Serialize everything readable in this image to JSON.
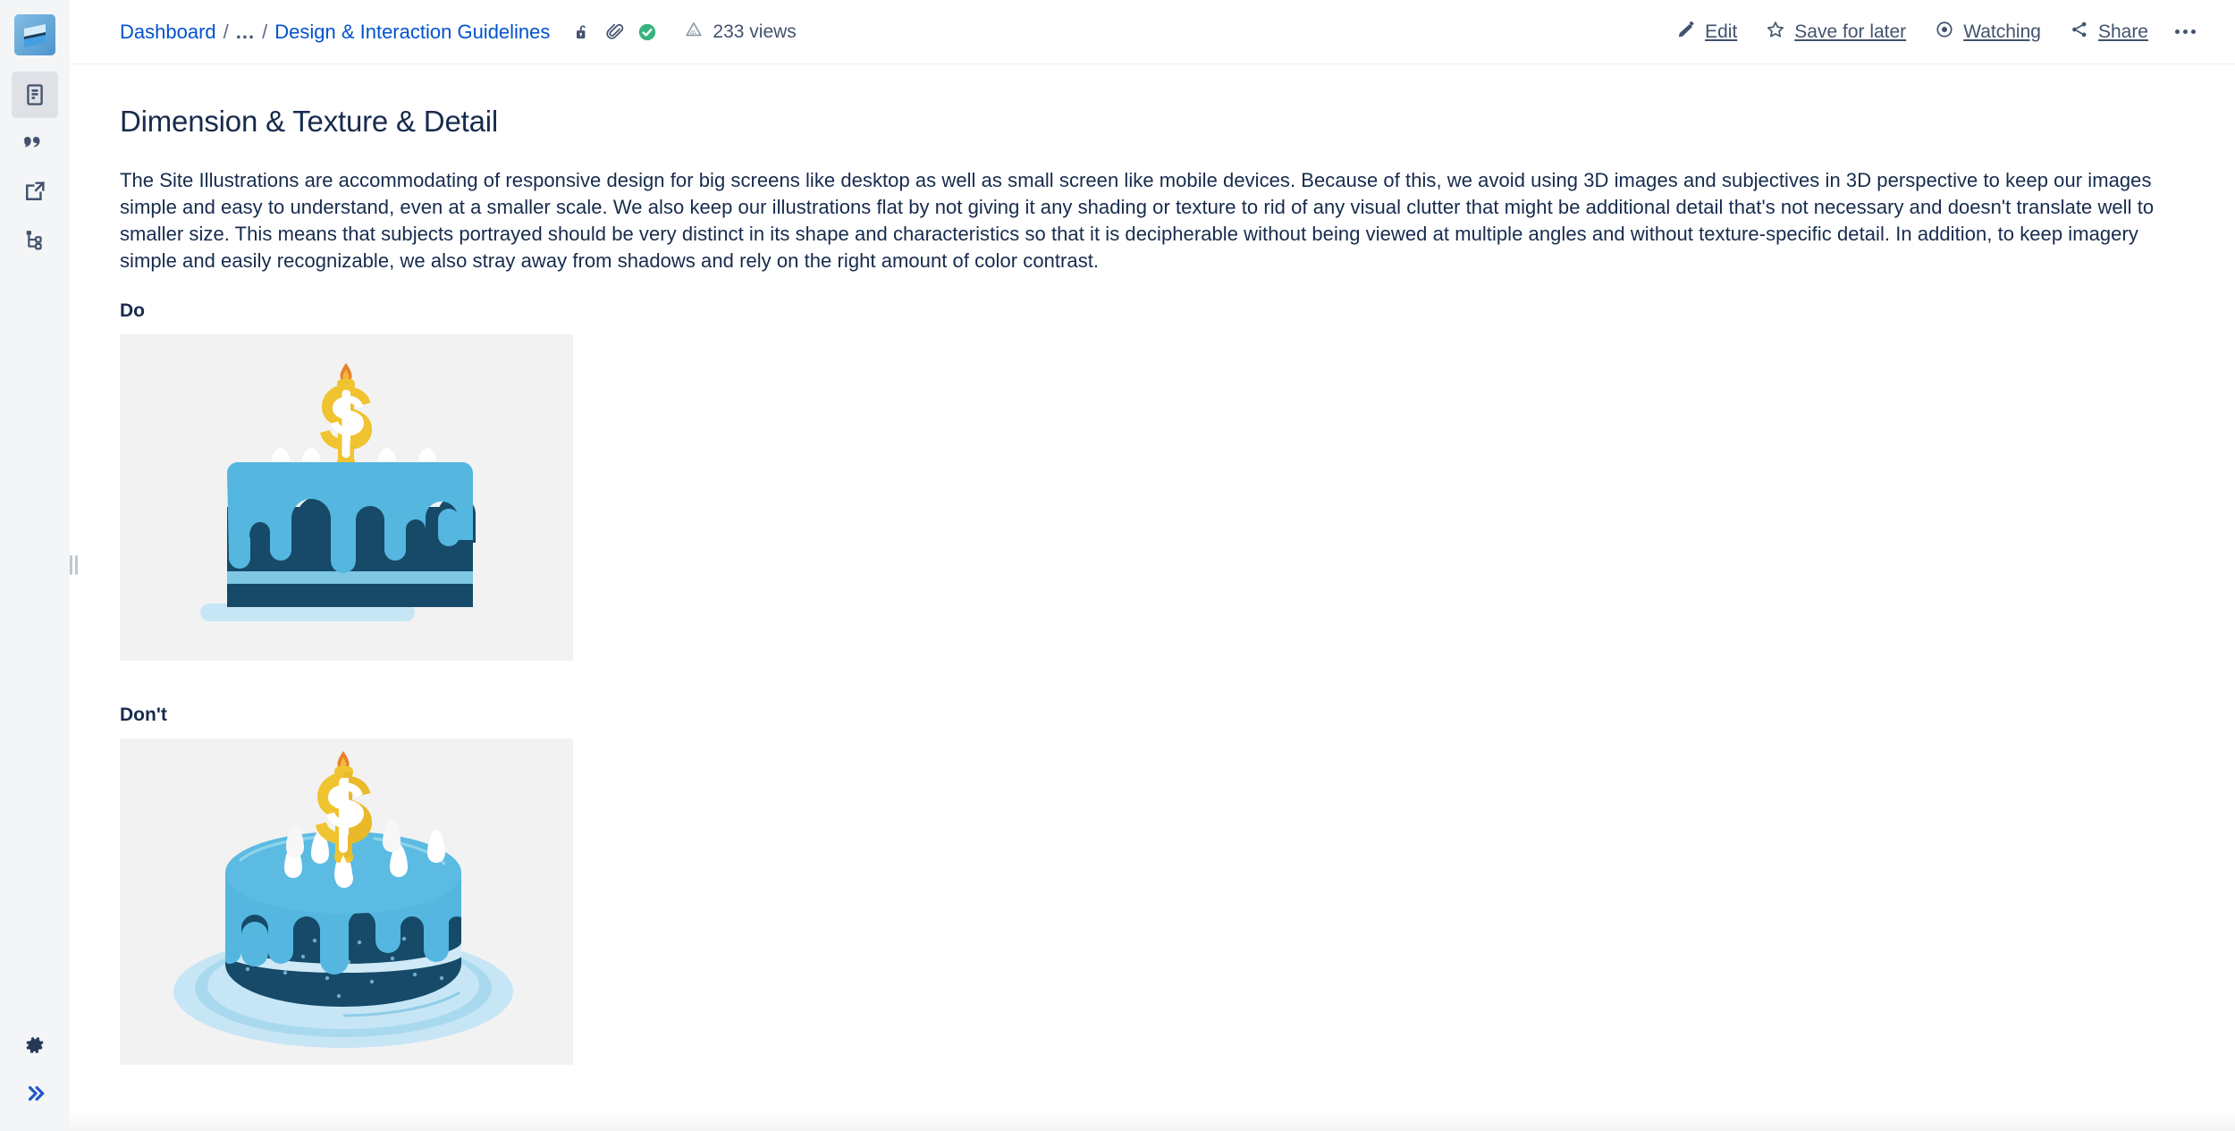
{
  "app": {
    "logo_name": "confluence-logo"
  },
  "sidebar": {
    "items": [
      {
        "id": "pages",
        "icon": "page-document-icon",
        "active": true
      },
      {
        "id": "blog",
        "icon": "quote-blog-icon",
        "active": false
      },
      {
        "id": "shortcuts",
        "icon": "external-link-icon",
        "active": false
      },
      {
        "id": "page-tree",
        "icon": "page-tree-icon",
        "active": false
      }
    ],
    "bottom_items": [
      {
        "id": "settings",
        "icon": "gear-icon"
      },
      {
        "id": "expand",
        "icon": "double-chevron-right-icon"
      }
    ],
    "resize_handle": "sidebar-resize-handle"
  },
  "header": {
    "breadcrumbs": [
      {
        "label": "Dashboard",
        "type": "link"
      },
      {
        "label": "...",
        "type": "ellipsis"
      },
      {
        "label": "Design & Interaction Guidelines",
        "type": "link"
      }
    ],
    "separator": "/",
    "status_icons": [
      {
        "name": "unlocked-padlock-icon",
        "color": "#42526e"
      },
      {
        "name": "paperclip-attachment-icon",
        "color": "#42526e"
      },
      {
        "name": "green-check-circle-icon",
        "color": "#36b37e"
      }
    ],
    "views": {
      "icon": "analytics-chart-icon",
      "label": "233 views",
      "count": 233
    },
    "actions": [
      {
        "id": "edit",
        "icon": "pencil-edit-icon",
        "label": "Edit"
      },
      {
        "id": "save-for-later",
        "icon": "star-outline-icon",
        "label": "Save for later"
      },
      {
        "id": "watching",
        "icon": "eye-watch-icon",
        "label": "Watching"
      },
      {
        "id": "share",
        "icon": "share-nodes-icon",
        "label": "Share"
      },
      {
        "id": "more",
        "icon": "more-horizontal-icon",
        "label": ""
      }
    ]
  },
  "main": {
    "title": "Dimension & Texture & Detail",
    "paragraph": "The Site Illustrations are accommodating of responsive design for big screens like desktop as well as small screen like mobile devices. Because of this, we avoid using 3D images and subjectives in 3D perspective to keep our images simple and easy to understand, even at a smaller scale. We also keep our illustrations flat by not giving it any shading or texture to rid of any visual clutter that might be additional detail that's not necessary and doesn't translate well to smaller size. This means that subjects portrayed should be very distinct in its shape and characteristics so that it is decipherable without being viewed at multiple angles and without texture-specific detail. In addition, to keep imagery simple and easily recognizable, we also stray away from shadows and rely on the right amount of color contrast.",
    "examples": [
      {
        "caption": "Do",
        "figure_name": "flat-cake-illustration",
        "alt": "Flat 2D birthday cake with dollar-sign candle"
      },
      {
        "caption": "Don't",
        "figure_name": "3d-cake-illustration",
        "alt": "3D perspective birthday cake with dollar-sign candle, shading and shadow"
      }
    ]
  },
  "colors": {
    "link": "#0052cc",
    "text": "#172b4d",
    "subtle_text": "#42526e",
    "rail_bg": "#f4f5f7",
    "rail_active": "#dfe1e6",
    "figure_bg": "#f2f2f2",
    "check_green": "#36b37e",
    "cake_light_blue": "#55b6e0",
    "cake_dark_blue": "#164a68",
    "cake_gold": "#f2c94c",
    "plate_blue": "#c7e6f5"
  }
}
